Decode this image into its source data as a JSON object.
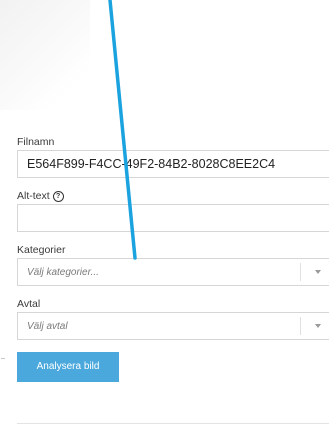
{
  "form": {
    "filename_label": "Filnamn",
    "filename_value": "E564F899-F4CC-49F2-84B2-8028C8EE2C4",
    "alt_text_label": "Alt-text",
    "alt_text_value": "",
    "categories_label": "Kategorier",
    "categories_placeholder": "Välj kategorier...",
    "agreement_label": "Avtal",
    "agreement_placeholder": "Välj avtal",
    "analyze_button_label": "Analysera bild",
    "help_icon": "question-circle-icon",
    "dropdown_icon": "caret-down-icon"
  },
  "colors": {
    "button": "#4aa8dc",
    "annotation_line": "#1ba3e0"
  }
}
